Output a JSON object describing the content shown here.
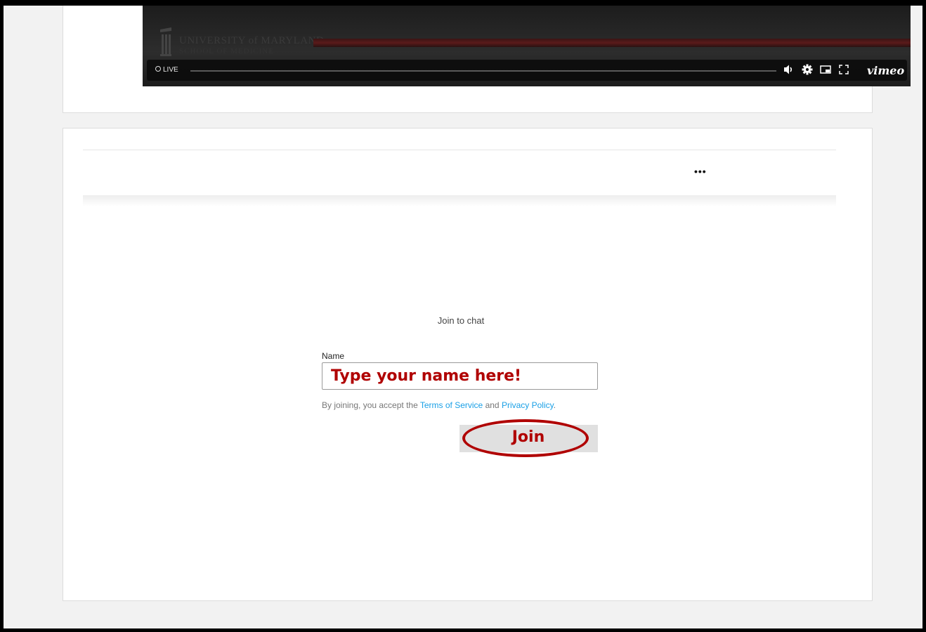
{
  "video": {
    "live_label": "LIVE",
    "brand": "vimeo",
    "logo_line1": "UNIVERSITY of MARYLAND",
    "logo_line2": "SCHOOL OF MEDICINE"
  },
  "chat": {
    "more_label": "•••",
    "join_title": "Join to chat",
    "name_label": "Name",
    "name_annotation": "Type your name here!",
    "terms_prefix": "By joining, you accept the ",
    "terms_link": "Terms of Service",
    "terms_mid": " and ",
    "privacy_link": "Privacy Policy",
    "terms_suffix": ".",
    "join_button": "Join"
  },
  "colors": {
    "annotation_red": "#b00000",
    "link_blue": "#1aa0e6"
  }
}
